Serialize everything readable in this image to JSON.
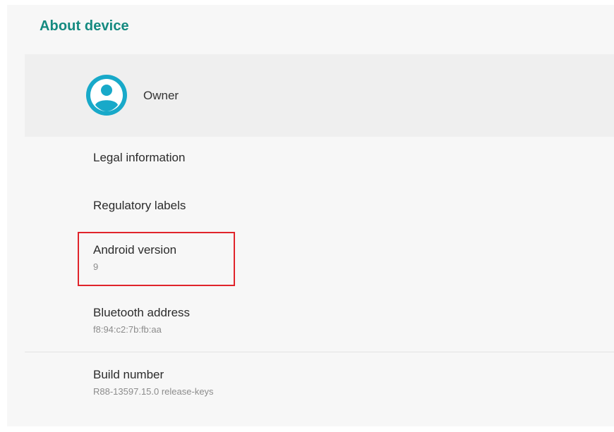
{
  "header": {
    "title": "About device"
  },
  "owner": {
    "name": "Owner",
    "avatar_icon": "account-circle-icon",
    "avatar_color": "#18a9c9"
  },
  "items": [
    {
      "title": "Legal information"
    },
    {
      "title": "Regulatory labels"
    },
    {
      "title": "Android version",
      "subtitle": "9"
    },
    {
      "title": "Bluetooth address",
      "subtitle": "f8:94:c2:7b:fb:aa"
    },
    {
      "title": "Build number",
      "subtitle": "R88-13597.15.0 release-keys"
    }
  ],
  "colors": {
    "accent": "#148a80",
    "highlight": "#e0242b"
  }
}
